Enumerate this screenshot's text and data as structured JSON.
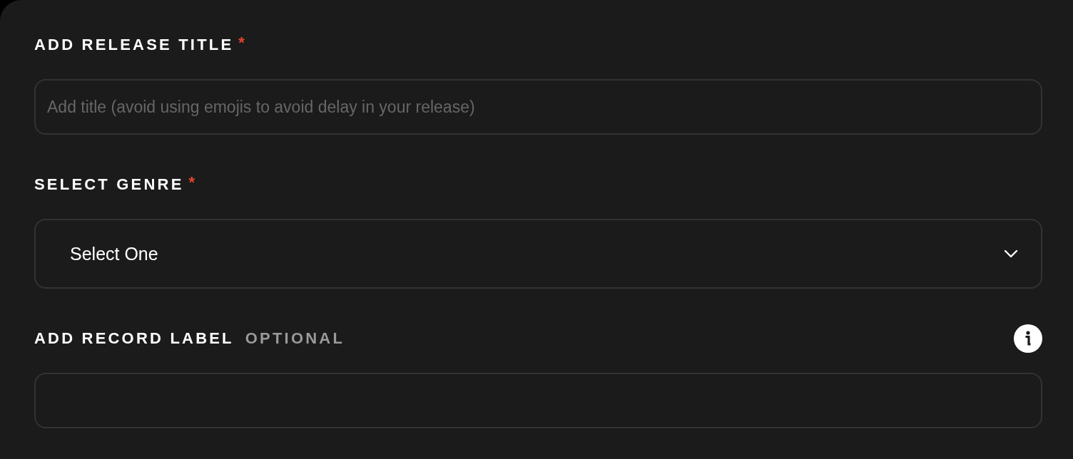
{
  "fields": [
    {
      "kind": "text",
      "label": "ADD RELEASE TITLE",
      "required_mark": "*",
      "placeholder": "Add title (avoid using emojis to avoid delay in your release)",
      "info_button": false
    },
    {
      "kind": "select",
      "label": "SELECT GENRE",
      "required_mark": "*",
      "value": "Select One",
      "info_button": false
    },
    {
      "kind": "text",
      "label": "ADD RECORD LABEL",
      "optional_tag": "OPTIONAL",
      "info_button": true
    }
  ]
}
